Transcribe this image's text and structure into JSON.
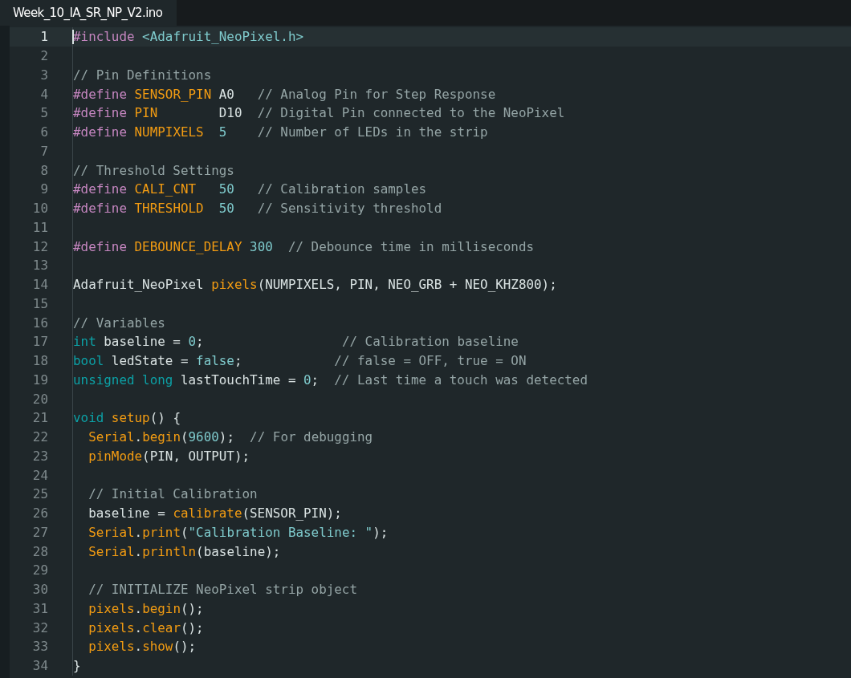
{
  "tabs": [
    {
      "label": "Week_10_IA_SR_NP_V2.ino",
      "selected": true
    }
  ],
  "editor": {
    "lines": [
      {
        "number": "1",
        "current": true,
        "tokens": [
          {
            "kind": "directive",
            "text": "#include "
          },
          {
            "kind": "string",
            "text": "<Adafruit_NeoPixel.h>"
          }
        ]
      },
      {
        "number": "2",
        "current": false
      },
      {
        "number": "3",
        "current": false,
        "tokens": [
          {
            "kind": "comment",
            "text": "// Pin Definitions"
          }
        ]
      },
      {
        "number": "4",
        "current": false,
        "tokens": [
          {
            "kind": "directive",
            "text": "#define "
          },
          {
            "kind": "macro",
            "text": "SENSOR_PIN"
          },
          {
            "kind": "plain",
            "text": " A0   "
          },
          {
            "kind": "comment",
            "text": "// Analog Pin for Step Response"
          }
        ]
      },
      {
        "number": "5",
        "current": false,
        "tokens": [
          {
            "kind": "directive",
            "text": "#define "
          },
          {
            "kind": "macro",
            "text": "PIN"
          },
          {
            "kind": "plain",
            "text": "        D10  "
          },
          {
            "kind": "comment",
            "text": "// Digital Pin connected to the NeoPixel"
          }
        ]
      },
      {
        "number": "6",
        "current": false,
        "tokens": [
          {
            "kind": "directive",
            "text": "#define "
          },
          {
            "kind": "macro",
            "text": "NUMPIXELS  "
          },
          {
            "kind": "number",
            "text": "5    "
          },
          {
            "kind": "comment",
            "text": "// Number of LEDs in the strip"
          }
        ]
      },
      {
        "number": "7",
        "current": false
      },
      {
        "number": "8",
        "current": false,
        "tokens": [
          {
            "kind": "comment",
            "text": "// Threshold Settings"
          }
        ]
      },
      {
        "number": "9",
        "current": false,
        "tokens": [
          {
            "kind": "directive",
            "text": "#define "
          },
          {
            "kind": "macro",
            "text": "CALI_CNT   "
          },
          {
            "kind": "number",
            "text": "50   "
          },
          {
            "kind": "comment",
            "text": "// Calibration samples"
          }
        ]
      },
      {
        "number": "10",
        "current": false,
        "tokens": [
          {
            "kind": "directive",
            "text": "#define "
          },
          {
            "kind": "macro",
            "text": "THRESHOLD  "
          },
          {
            "kind": "number",
            "text": "50   "
          },
          {
            "kind": "comment",
            "text": "// Sensitivity threshold"
          }
        ]
      },
      {
        "number": "11",
        "current": false
      },
      {
        "number": "12",
        "current": false,
        "tokens": [
          {
            "kind": "directive",
            "text": "#define "
          },
          {
            "kind": "macro",
            "text": "DEBOUNCE_DELAY "
          },
          {
            "kind": "number",
            "text": "300  "
          },
          {
            "kind": "comment",
            "text": "// Debounce time in milliseconds"
          }
        ]
      },
      {
        "number": "13",
        "current": false
      },
      {
        "number": "14",
        "current": false,
        "tokens": [
          {
            "kind": "plain",
            "text": "Adafruit_NeoPixel "
          },
          {
            "kind": "function",
            "text": "pixels"
          },
          {
            "kind": "plain",
            "text": "(NUMPIXELS, PIN, NEO_GRB + NEO_KHZ800);"
          }
        ]
      },
      {
        "number": "15",
        "current": false
      },
      {
        "number": "16",
        "current": false,
        "tokens": [
          {
            "kind": "comment",
            "text": "// Variables"
          }
        ]
      },
      {
        "number": "17",
        "current": false,
        "tokens": [
          {
            "kind": "type",
            "text": "int"
          },
          {
            "kind": "plain",
            "text": " baseline = "
          },
          {
            "kind": "number",
            "text": "0"
          },
          {
            "kind": "plain",
            "text": ";                  "
          },
          {
            "kind": "comment",
            "text": "// Calibration baseline"
          }
        ]
      },
      {
        "number": "18",
        "current": false,
        "tokens": [
          {
            "kind": "type",
            "text": "bool"
          },
          {
            "kind": "plain",
            "text": " ledState = "
          },
          {
            "kind": "number",
            "text": "false"
          },
          {
            "kind": "plain",
            "text": ";            "
          },
          {
            "kind": "comment",
            "text": "// false = OFF, true = ON"
          }
        ]
      },
      {
        "number": "19",
        "current": false,
        "tokens": [
          {
            "kind": "type",
            "text": "unsigned long"
          },
          {
            "kind": "plain",
            "text": " lastTouchTime = "
          },
          {
            "kind": "number",
            "text": "0"
          },
          {
            "kind": "plain",
            "text": ";  "
          },
          {
            "kind": "comment",
            "text": "// Last time a touch was detected"
          }
        ]
      },
      {
        "number": "20",
        "current": false
      },
      {
        "number": "21",
        "current": false,
        "tokens": [
          {
            "kind": "type",
            "text": "void "
          },
          {
            "kind": "function",
            "text": "setup"
          },
          {
            "kind": "plain",
            "text": "() {"
          }
        ]
      },
      {
        "number": "22",
        "current": false,
        "tokens": [
          {
            "kind": "function",
            "text": "  Serial"
          },
          {
            "kind": "plain",
            "text": "."
          },
          {
            "kind": "function",
            "text": "begin"
          },
          {
            "kind": "plain",
            "text": "("
          },
          {
            "kind": "number",
            "text": "9600"
          },
          {
            "kind": "plain",
            "text": ");  "
          },
          {
            "kind": "comment",
            "text": "// For debugging"
          }
        ]
      },
      {
        "number": "23",
        "current": false,
        "tokens": [
          {
            "kind": "function",
            "text": "  pinMode"
          },
          {
            "kind": "plain",
            "text": "(PIN, OUTPUT);"
          }
        ]
      },
      {
        "number": "24",
        "current": false
      },
      {
        "number": "25",
        "current": false,
        "tokens": [
          {
            "kind": "comment",
            "text": "  // Initial Calibration"
          }
        ]
      },
      {
        "number": "26",
        "current": false,
        "tokens": [
          {
            "kind": "plain",
            "text": "  baseline = "
          },
          {
            "kind": "function",
            "text": "calibrate"
          },
          {
            "kind": "plain",
            "text": "(SENSOR_PIN);"
          }
        ]
      },
      {
        "number": "27",
        "current": false,
        "tokens": [
          {
            "kind": "function",
            "text": "  Serial"
          },
          {
            "kind": "plain",
            "text": "."
          },
          {
            "kind": "function",
            "text": "print"
          },
          {
            "kind": "plain",
            "text": "("
          },
          {
            "kind": "string",
            "text": "\"Calibration Baseline: \""
          },
          {
            "kind": "plain",
            "text": ");"
          }
        ]
      },
      {
        "number": "28",
        "current": false,
        "tokens": [
          {
            "kind": "function",
            "text": "  Serial"
          },
          {
            "kind": "plain",
            "text": "."
          },
          {
            "kind": "function",
            "text": "println"
          },
          {
            "kind": "plain",
            "text": "(baseline);"
          }
        ]
      },
      {
        "number": "29",
        "current": false
      },
      {
        "number": "30",
        "current": false,
        "tokens": [
          {
            "kind": "comment",
            "text": "  // INITIALIZE NeoPixel strip object"
          }
        ]
      },
      {
        "number": "31",
        "current": false,
        "tokens": [
          {
            "kind": "function",
            "text": "  pixels"
          },
          {
            "kind": "plain",
            "text": "."
          },
          {
            "kind": "function",
            "text": "begin"
          },
          {
            "kind": "plain",
            "text": "();"
          }
        ]
      },
      {
        "number": "32",
        "current": false,
        "tokens": [
          {
            "kind": "function",
            "text": "  pixels"
          },
          {
            "kind": "plain",
            "text": "."
          },
          {
            "kind": "function",
            "text": "clear"
          },
          {
            "kind": "plain",
            "text": "();"
          }
        ]
      },
      {
        "number": "33",
        "current": false,
        "tokens": [
          {
            "kind": "function",
            "text": "  pixels"
          },
          {
            "kind": "plain",
            "text": "."
          },
          {
            "kind": "function",
            "text": "show"
          },
          {
            "kind": "plain",
            "text": "();"
          }
        ]
      },
      {
        "number": "34",
        "current": false,
        "tokens": [
          {
            "kind": "plain",
            "text": "}"
          }
        ]
      }
    ]
  }
}
